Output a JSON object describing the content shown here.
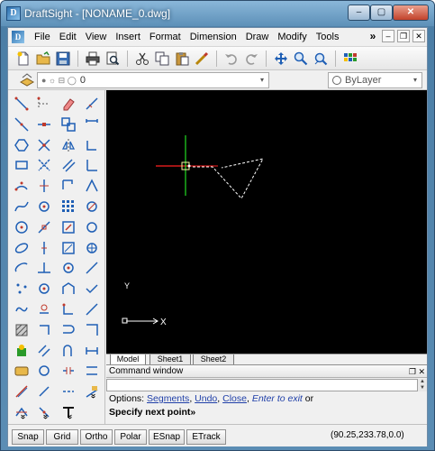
{
  "window": {
    "title": "DraftSight - [NONAME_0.dwg]",
    "app_icon_letter": "D",
    "min_glyph": "‒",
    "max_glyph": "▢",
    "close_glyph": "✕"
  },
  "menu": {
    "items": [
      "File",
      "Edit",
      "View",
      "Insert",
      "Format",
      "Dimension",
      "Draw",
      "Modify",
      "Tools"
    ],
    "overflow_glyph": "»",
    "doc_min_glyph": "‒",
    "doc_restore_glyph": "❐",
    "doc_close_glyph": "✕"
  },
  "toolbar": {
    "icons": [
      "new-icon",
      "open-icon",
      "save-icon",
      "print-icon",
      "print-preview-icon",
      "cut-icon",
      "copy-icon",
      "paste-icon",
      "match-properties-icon",
      "undo-icon",
      "redo-icon",
      "pan-icon",
      "zoom-window-icon",
      "zoom-previous-icon",
      "tool-palettes-icon"
    ]
  },
  "layers": {
    "current_layer": "0",
    "color_combo": "ByLayer",
    "arrow": "▾"
  },
  "tabs": [
    "Model",
    "Sheet1",
    "Sheet2"
  ],
  "command_window": {
    "title": "Command window",
    "prompt_prefix": "Options: ",
    "options": [
      "Segments",
      "Undo",
      "Close"
    ],
    "separator": ", ",
    "enter_to_exit": "Enter to exit",
    "or_text": "or",
    "specify": "Specify next point»",
    "float_glyph": "❐",
    "close_glyph": "✕",
    "scroll_up": "▲",
    "scroll_down": "▼"
  },
  "status": {
    "buttons": [
      "Snap",
      "Grid",
      "Ortho",
      "Polar",
      "ESnap",
      "ETrack"
    ],
    "coordinates": "(90.25,233.78,0.0)"
  },
  "sidebar": {
    "chevron": "»",
    "colors": {
      "accent": "#1f5fb5",
      "red": "#c0392b"
    }
  },
  "canvas": {
    "background": "#000000",
    "crosshair_x_color": "#ff2020",
    "crosshair_y_color": "#22dd22",
    "ucs_x_label": "X",
    "ucs_y_label": "Y"
  }
}
